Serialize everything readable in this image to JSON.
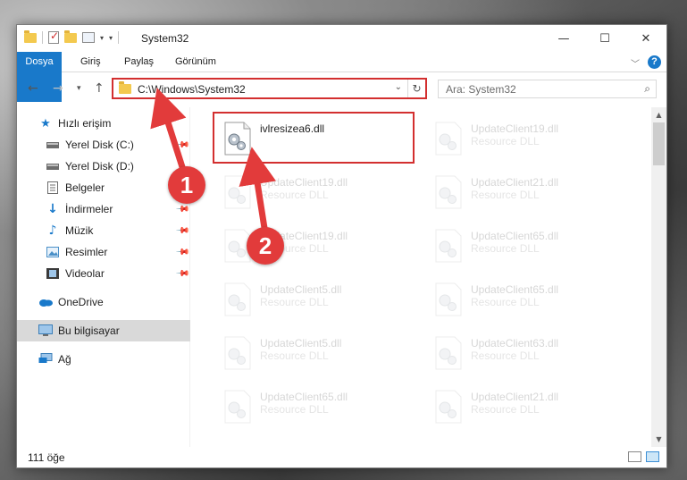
{
  "window": {
    "title": "System32"
  },
  "ribbon": {
    "tabs": [
      "Dosya",
      "Giriş",
      "Paylaş",
      "Görünüm"
    ]
  },
  "nav": {
    "address": "C:\\Windows\\System32",
    "search_placeholder": "Ara: System32"
  },
  "sidebar": {
    "items": [
      {
        "label": "Hızlı erişim",
        "icon": "star-icon"
      },
      {
        "label": "Yerel Disk (C:)",
        "icon": "drive-icon"
      },
      {
        "label": "Yerel Disk (D:)",
        "icon": "drive-icon"
      },
      {
        "label": "Belgeler",
        "icon": "document-icon"
      },
      {
        "label": "İndirmeler",
        "icon": "download-icon"
      },
      {
        "label": "Müzik",
        "icon": "music-icon"
      },
      {
        "label": "Resimler",
        "icon": "pictures-icon"
      },
      {
        "label": "Videolar",
        "icon": "video-icon"
      },
      {
        "label": "OneDrive",
        "icon": "cloud-icon"
      },
      {
        "label": "Bu bilgisayar",
        "icon": "computer-icon"
      },
      {
        "label": "Ağ",
        "icon": "network-icon"
      }
    ]
  },
  "files": {
    "type": "Resource DLL",
    "items": [
      {
        "name": "ivlresizea6.dll",
        "type": ""
      },
      {
        "name": "UpdateClient19.dll",
        "type": "Resource DLL"
      },
      {
        "name": "UpdateClient19.dll",
        "type": "Resource DLL"
      },
      {
        "name": "UpdateClient21.dll",
        "type": "Resource DLL"
      },
      {
        "name": "UpdateClient19.dll",
        "type": "Resource DLL"
      },
      {
        "name": "UpdateClient65.dll",
        "type": "Resource DLL"
      },
      {
        "name": "UpdateClient5.dll",
        "type": "Resource DLL"
      },
      {
        "name": "UpdateClient65.dll",
        "type": "Resource DLL"
      },
      {
        "name": "UpdateClient5.dll",
        "type": "Resource DLL"
      },
      {
        "name": "UpdateClient63.dll",
        "type": "Resource DLL"
      },
      {
        "name": "UpdateClient65.dll",
        "type": "Resource DLL"
      },
      {
        "name": "UpdateClient21.dll",
        "type": "Resource DLL"
      }
    ]
  },
  "status": {
    "count": "111 öğe"
  },
  "annotations": {
    "step1": "1",
    "step2": "2",
    "color": "#e23b3b"
  }
}
